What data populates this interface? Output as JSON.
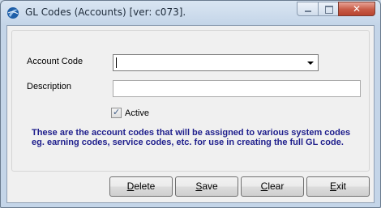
{
  "window": {
    "title": "GL Codes (Accounts) [ver: c073]."
  },
  "controls": {
    "minimize": "minimize-icon",
    "maximize": "maximize-icon",
    "close": "close-icon"
  },
  "form": {
    "account_code_label": "Account Code",
    "account_code_value": "",
    "description_label": "Description",
    "description_value": "",
    "active_label": "Active",
    "active_checked": true,
    "info_text": "These are the account codes that will be assigned to various system codes eg. earning codes, service codes, etc. for use in creating the full GL code."
  },
  "buttons": {
    "delete": {
      "first": "D",
      "rest": "elete"
    },
    "save": {
      "first": "S",
      "rest": "ave"
    },
    "clear": {
      "first": "C",
      "rest": "lear"
    },
    "exit": {
      "first": "E",
      "rest": "xit"
    }
  },
  "colors": {
    "info_text": "#1e1e8c",
    "title_gradient_top": "#d9e5f2",
    "client_bg": "#f0f0f0"
  }
}
